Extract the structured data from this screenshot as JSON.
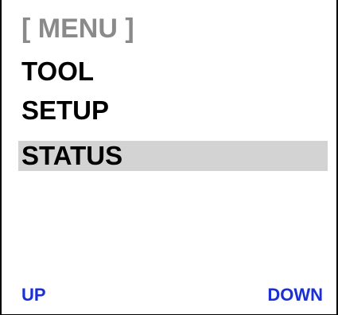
{
  "menu": {
    "title": "[ MENU ]",
    "items": [
      {
        "label": "TOOL",
        "selected": false
      },
      {
        "label": "SETUP",
        "selected": false
      },
      {
        "label": "STATUS",
        "selected": true
      }
    ]
  },
  "softkeys": {
    "up_label": "UP",
    "down_label": "DOWN"
  },
  "colors": {
    "title": "#8a8a8a",
    "item_text": "#000000",
    "selection_highlight": "#d3d3d3",
    "softkey": "#1a2fd6"
  }
}
